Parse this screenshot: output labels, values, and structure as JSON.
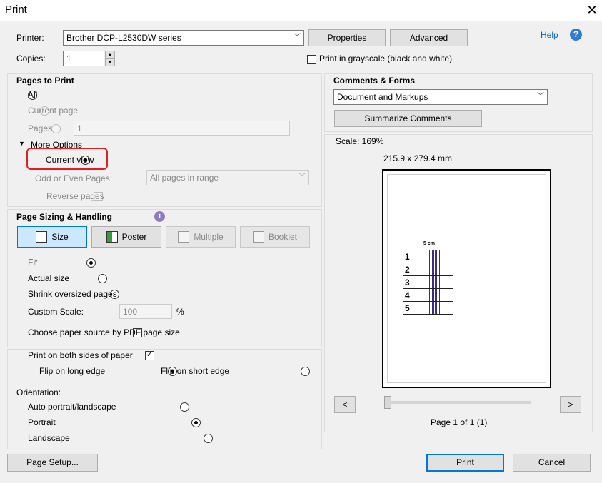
{
  "window": {
    "title": "Print",
    "close_glyph": "✕"
  },
  "printer": {
    "label": "Printer:",
    "value": "Brother DCP-L2530DW series",
    "properties": "Properties",
    "advanced": "Advanced",
    "help": "Help"
  },
  "copies": {
    "label": "Copies:",
    "value": "1"
  },
  "grayscale": {
    "label": "Print in grayscale (black and white)",
    "checked": false
  },
  "pages_to_print": {
    "title": "Pages to Print",
    "all": "All",
    "current_page": "Current page",
    "pages": "Pages",
    "pages_value": "1",
    "more_options": "More Options",
    "current_view": "Current view",
    "odd_even_label": "Odd or Even Pages:",
    "odd_even_value": "All pages in range",
    "reverse_pages": "Reverse pages"
  },
  "sizing": {
    "title": "Page Sizing & Handling",
    "buttons": [
      "Size",
      "Poster",
      "Multiple",
      "Booklet"
    ],
    "fit": "Fit",
    "actual_size": "Actual size",
    "shrink": "Shrink oversized pages",
    "custom_scale": "Custom Scale:",
    "custom_scale_value": "100",
    "percent": "%",
    "paper_source": "Choose paper source by PDF page size"
  },
  "duplex": {
    "both_sides": "Print on both sides of paper",
    "long_edge": "Flip on long edge",
    "short_edge": "Flip on short edge"
  },
  "orientation": {
    "label": "Orientation:",
    "auto": "Auto portrait/landscape",
    "portrait": "Portrait",
    "landscape": "Landscape"
  },
  "comments_forms": {
    "title": "Comments & Forms",
    "value": "Document and Markups",
    "summarize": "Summarize Comments"
  },
  "preview": {
    "scale": "Scale: 169%",
    "dimensions": "215.9 x 279.4 mm",
    "prev": "<",
    "next": ">",
    "page_info": "Page 1 of 1 (1)",
    "page_position_fraction": 0,
    "ruler_title": "5 cm",
    "ruler_numbers": [
      "1",
      "2",
      "3",
      "4",
      "5"
    ]
  },
  "footer": {
    "page_setup": "Page Setup...",
    "print": "Print",
    "cancel": "Cancel"
  },
  "colors": {
    "accent": "#0078d7",
    "highlight": "#e02020",
    "link": "#0066cc"
  }
}
